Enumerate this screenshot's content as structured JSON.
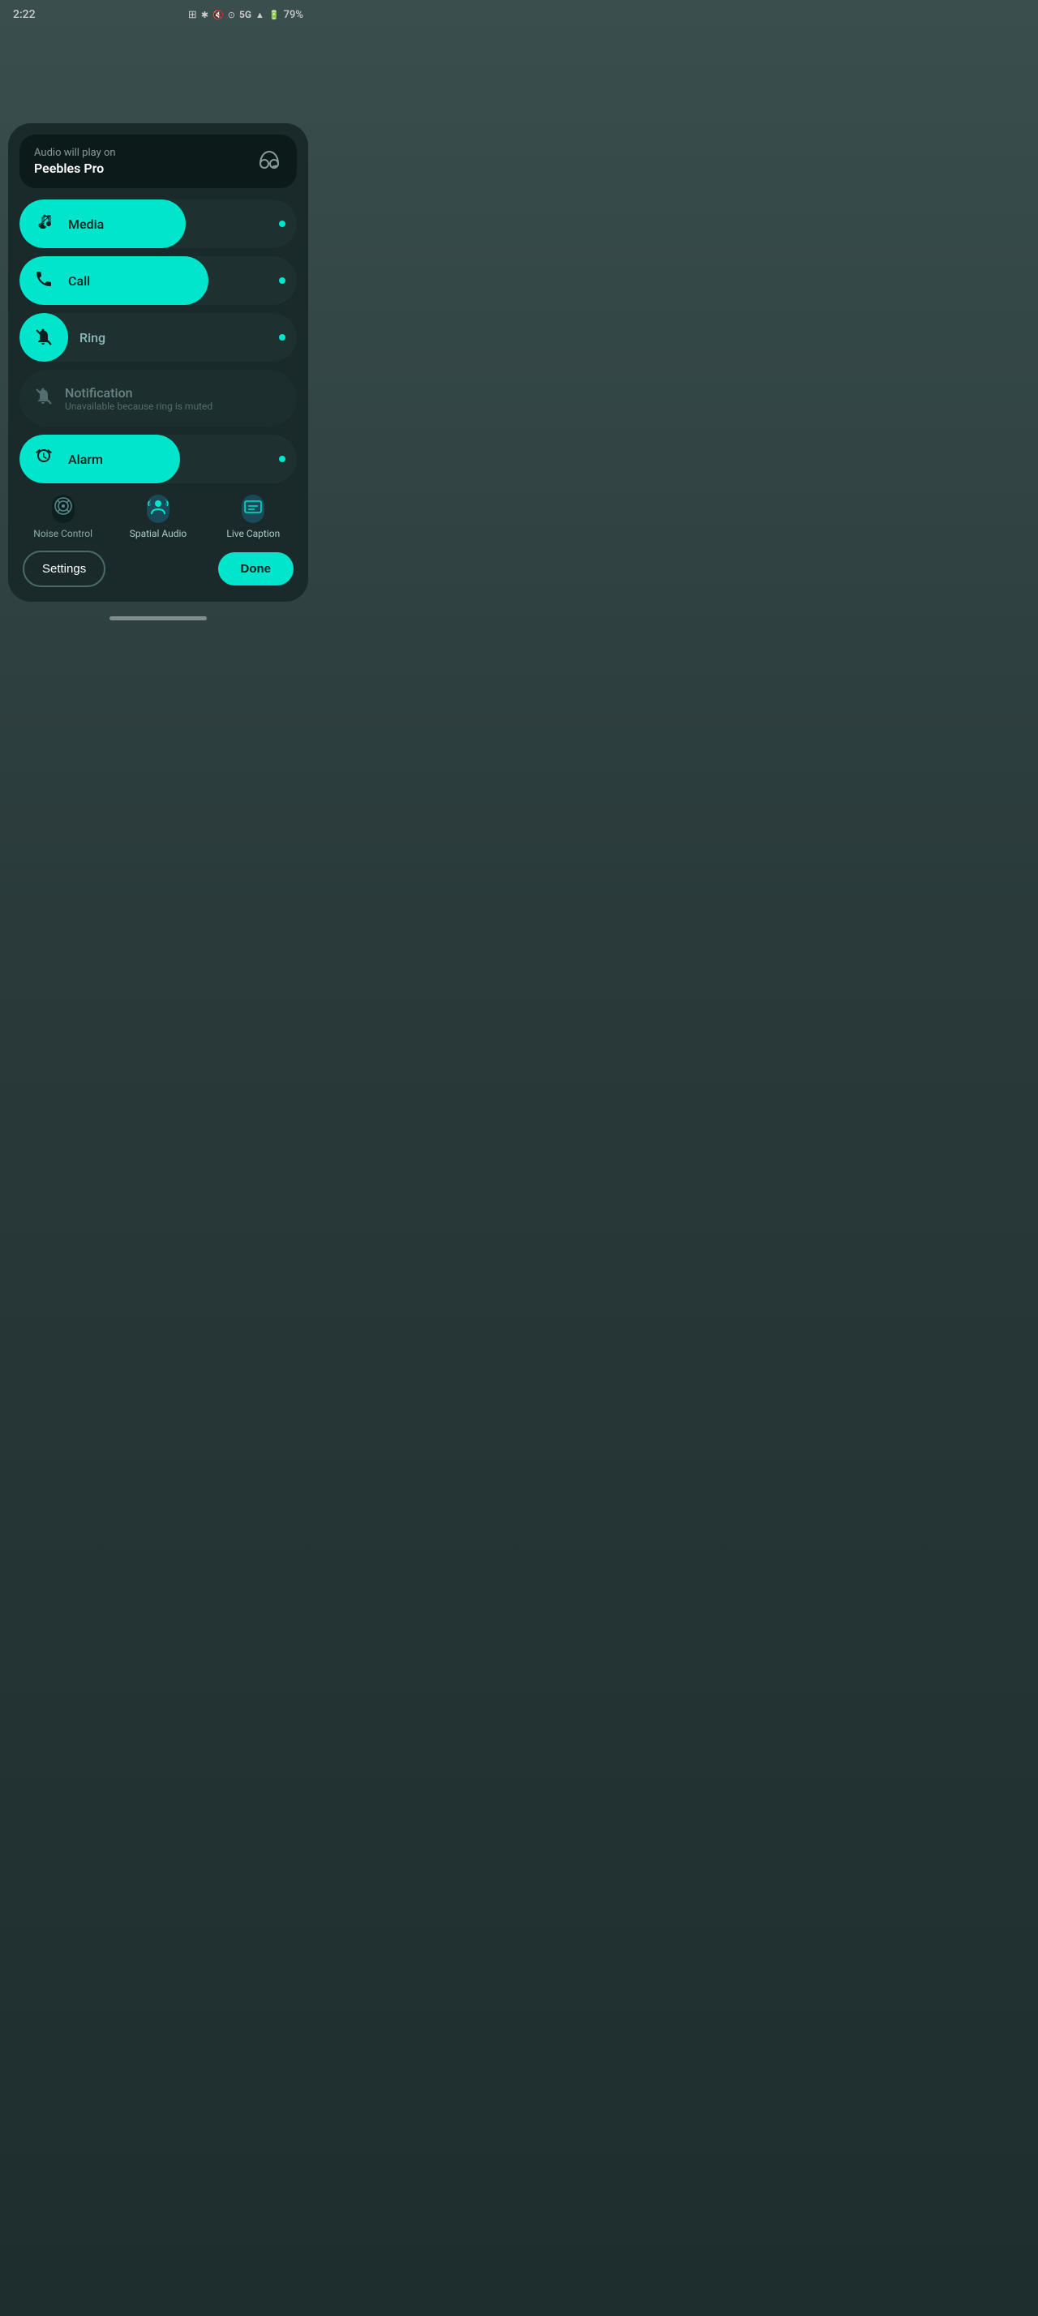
{
  "statusBar": {
    "time": "2:22",
    "icons": [
      "👓",
      "✱",
      "🔇",
      "⊙",
      "5G",
      "▲",
      "🔋",
      "79%"
    ]
  },
  "audioDevice": {
    "label": "Audio will play on",
    "deviceName": "Peebles Pro"
  },
  "volumeSliders": [
    {
      "id": "media",
      "label": "Media",
      "fillPercent": 60,
      "icon": "♪",
      "hasDot": true
    },
    {
      "id": "call",
      "label": "Call",
      "fillPercent": 68,
      "icon": "📞",
      "hasDot": true
    },
    {
      "id": "ring",
      "label": "Ring",
      "fillPercent": 0,
      "icon": "🔇",
      "muted": true,
      "hasDot": true
    },
    {
      "id": "alarm",
      "label": "Alarm",
      "fillPercent": 58,
      "icon": "⏰",
      "hasDot": true
    }
  ],
  "notification": {
    "label": "Notification",
    "sublabel": "Unavailable because ring is muted",
    "icon": "🔇"
  },
  "quickActions": [
    {
      "id": "noise-control",
      "label": "Noise Control",
      "active": false
    },
    {
      "id": "spatial-audio",
      "label": "Spatial Audio",
      "active": true
    },
    {
      "id": "live-caption",
      "label": "Live Caption",
      "active": true
    }
  ],
  "buttons": {
    "settings": "Settings",
    "done": "Done"
  }
}
